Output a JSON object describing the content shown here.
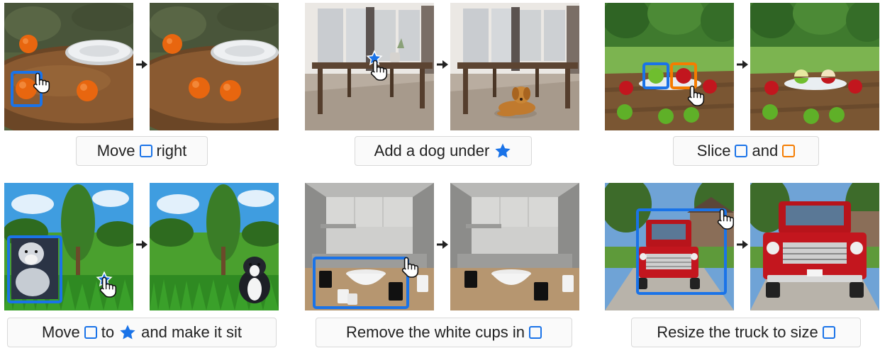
{
  "colors": {
    "blue": "#1a73e8",
    "orange": "#f57c00"
  },
  "examples": [
    {
      "caption": {
        "t1": "Move",
        "t2": "right"
      }
    },
    {
      "caption": {
        "t1": "Add a dog under"
      }
    },
    {
      "caption": {
        "t1": "Slice",
        "t2": "and"
      }
    },
    {
      "caption": {
        "t1": "Move",
        "t2": "to",
        "t3": "and make it sit"
      }
    },
    {
      "caption": {
        "t1": "Remove the white cups in"
      }
    },
    {
      "caption": {
        "t1": "Resize the truck to size"
      }
    }
  ]
}
